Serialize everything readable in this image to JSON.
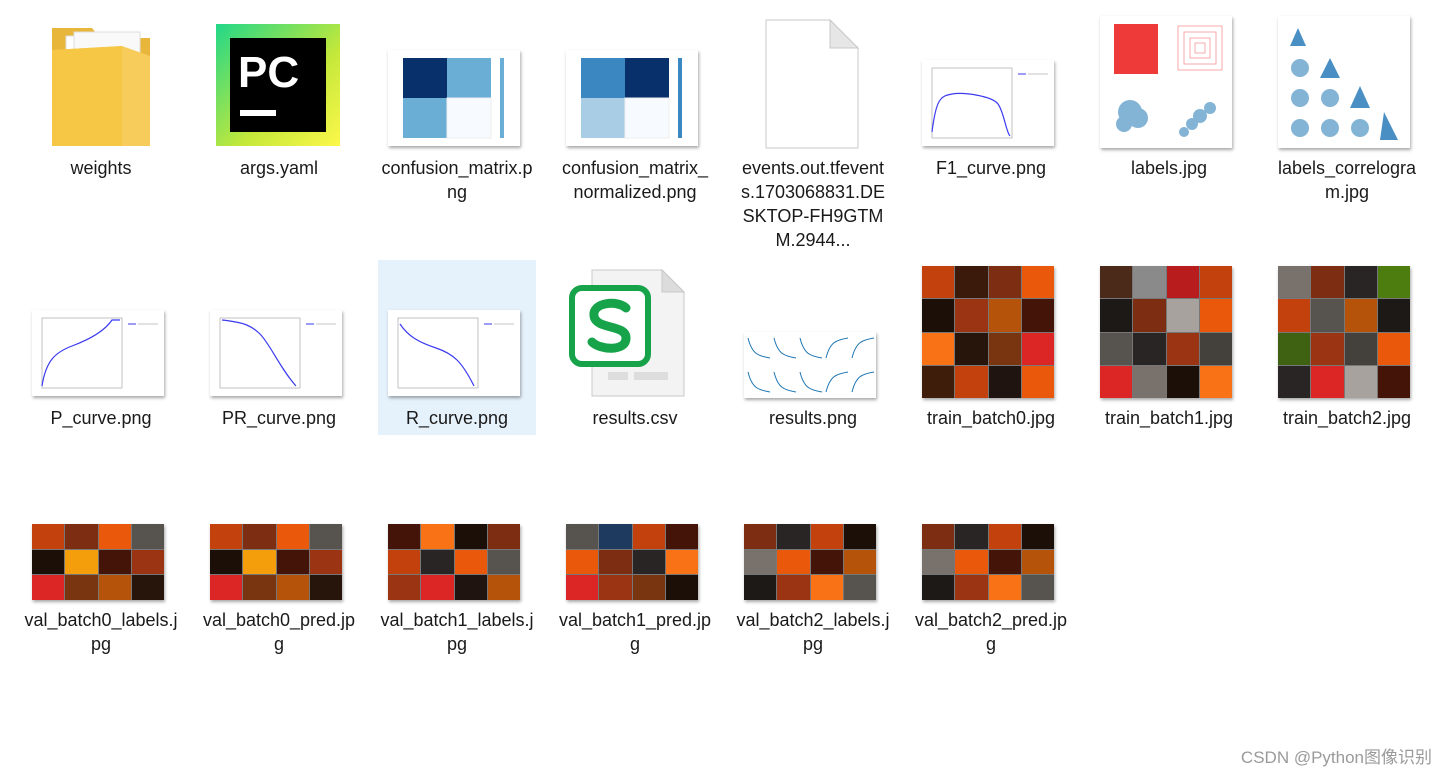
{
  "files": [
    {
      "name": "weights",
      "icon": "folder-icon"
    },
    {
      "name": "args.yaml",
      "icon": "pycharm-icon"
    },
    {
      "name": "confusion_matrix.png",
      "icon": "image-thumbnail-icon"
    },
    {
      "name": "confusion_matrix_normalized.png",
      "icon": "image-thumbnail-icon"
    },
    {
      "name": "events.out.tfevents.1703068831.DESKTOP-FH9GTMM.2944...",
      "icon": "blank-file-icon"
    },
    {
      "name": "F1_curve.png",
      "icon": "image-thumbnail-icon"
    },
    {
      "name": "labels.jpg",
      "icon": "image-thumbnail-icon"
    },
    {
      "name": "labels_correlogram.jpg",
      "icon": "image-thumbnail-icon"
    },
    {
      "name": "P_curve.png",
      "icon": "image-thumbnail-icon"
    },
    {
      "name": "PR_curve.png",
      "icon": "image-thumbnail-icon"
    },
    {
      "name": "R_curve.png",
      "icon": "image-thumbnail-icon",
      "selected": true
    },
    {
      "name": "results.csv",
      "icon": "spreadsheet-file-icon"
    },
    {
      "name": "results.png",
      "icon": "image-thumbnail-icon"
    },
    {
      "name": "train_batch0.jpg",
      "icon": "image-thumbnail-icon"
    },
    {
      "name": "train_batch1.jpg",
      "icon": "image-thumbnail-icon"
    },
    {
      "name": "train_batch2.jpg",
      "icon": "image-thumbnail-icon"
    },
    {
      "name": "val_batch0_labels.jpg",
      "icon": "image-thumbnail-icon"
    },
    {
      "name": "val_batch0_pred.jpg",
      "icon": "image-thumbnail-icon"
    },
    {
      "name": "val_batch1_labels.jpg",
      "icon": "image-thumbnail-icon"
    },
    {
      "name": "val_batch1_pred.jpg",
      "icon": "image-thumbnail-icon"
    },
    {
      "name": "val_batch2_labels.jpg",
      "icon": "image-thumbnail-icon"
    },
    {
      "name": "val_batch2_pred.jpg",
      "icon": "image-thumbnail-icon"
    }
  ],
  "app_icon_text": "PC",
  "watermark": "CSDN @Python图像识别",
  "colors": {
    "selection": "#e5f1fb",
    "folder": "#f5c542",
    "pycharm_green": "#21d789",
    "pycharm_yellow": "#fcf84a",
    "spreadsheet_green": "#17a34a",
    "matrix_dark": "#08306b",
    "matrix_mid": "#6aaed6",
    "curve_blue": "#3b3bf0"
  }
}
